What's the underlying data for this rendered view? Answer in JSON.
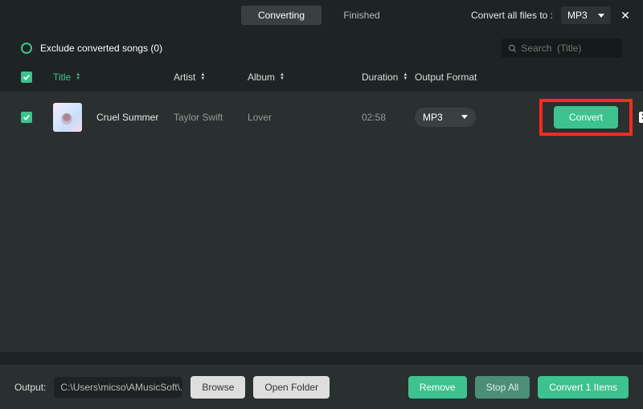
{
  "tabs": {
    "converting": "Converting",
    "finished": "Finished"
  },
  "convertAll": {
    "label": "Convert all files to :",
    "value": "MP3"
  },
  "exclude": "Exclude converted songs (0)",
  "search": {
    "placeholder": "Search  (Title)"
  },
  "headers": {
    "title": "Title",
    "artist": "Artist",
    "album": "Album",
    "duration": "Duration",
    "format": "Output Format"
  },
  "row": {
    "title": "Cruel Summer",
    "artist": "Taylor Swift",
    "album": "Lover",
    "duration": "02:58",
    "format": "MP3",
    "convert": "Convert"
  },
  "footer": {
    "outputLabel": "Output:",
    "path": "C:\\Users\\micso\\AMusicSoft\\...",
    "browse": "Browse",
    "openFolder": "Open Folder",
    "remove": "Remove",
    "stopAll": "Stop All",
    "convertItems": "Convert 1 Items"
  }
}
